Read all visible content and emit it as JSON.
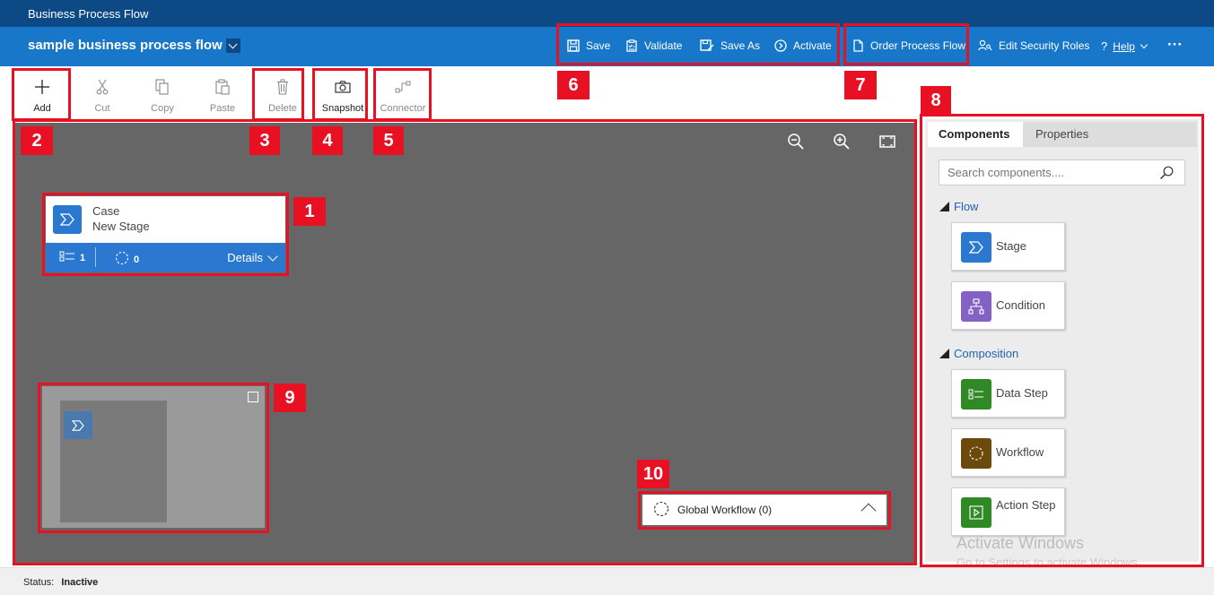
{
  "app_title": "Business Process Flow",
  "header": {
    "flow_name": "sample business process flow",
    "commands": {
      "save": "Save",
      "validate": "Validate",
      "save_as": "Save As",
      "activate": "Activate",
      "order_process_flow": "Order Process Flow",
      "edit_security_roles": "Edit Security Roles",
      "help": "Help",
      "more": "···"
    }
  },
  "toolbar": {
    "add": "Add",
    "cut": "Cut",
    "copy": "Copy",
    "paste": "Paste",
    "delete": "Delete",
    "snapshot": "Snapshot",
    "connector": "Connector"
  },
  "stage_card": {
    "entity": "Case",
    "stage_name": "New Stage",
    "data_steps_count": "1",
    "workflows_count": "0",
    "details_label": "Details"
  },
  "global_workflow": {
    "label": "Global Workflow (0)"
  },
  "panel": {
    "tabs": [
      "Components",
      "Properties"
    ],
    "search_placeholder": "Search components....",
    "sections": {
      "flow": {
        "title": "Flow",
        "items": [
          "Stage",
          "Condition"
        ]
      },
      "composition": {
        "title": "Composition",
        "items": [
          "Data Step",
          "Workflow",
          "Action Step"
        ]
      }
    },
    "colors": {
      "stage": "#2b78d0",
      "condition": "#8661c5",
      "data_step": "#2f8a26",
      "workflow": "#6b4a0c",
      "action_step": "#2f8a26"
    }
  },
  "watermark": {
    "line1": "Activate Windows",
    "line2": "Go to Settings to activate Windows."
  },
  "status": {
    "label": "Status:",
    "value": "Inactive"
  },
  "callouts": [
    "1",
    "2",
    "3",
    "4",
    "5",
    "6",
    "7",
    "8",
    "9",
    "10"
  ],
  "colors": {
    "title_bar": "#0d4a85",
    "command_bar": "#1877c9",
    "canvas": "#666666",
    "callout": "#e81123"
  }
}
